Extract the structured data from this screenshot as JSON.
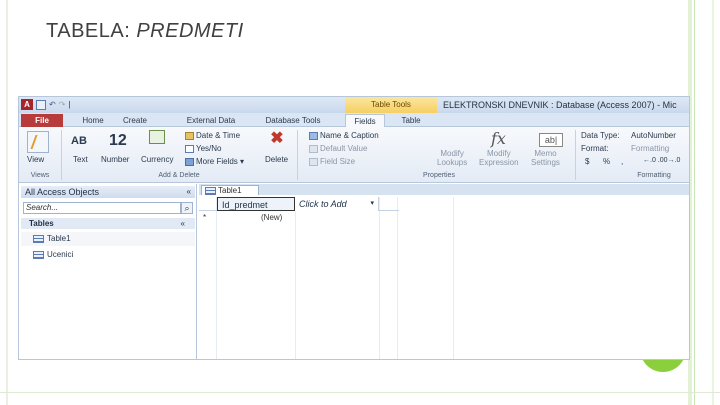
{
  "slide": {
    "title_plain": "Tabela: ",
    "title_italic": "Predmeti"
  },
  "window": {
    "title": "ELEKTRONSKI DNEVNIK : Database (Access 2007) - Mic",
    "contextual_tools": "Table Tools",
    "app_icon": "A",
    "qat_separator": "|"
  },
  "tabs": [
    "File",
    "Home",
    "Create",
    "External Data",
    "Database Tools",
    "Fields",
    "Table"
  ],
  "ribbon": {
    "view": "View",
    "views_label": "Views",
    "text_glyph": "AB",
    "text_label": "Text",
    "number_glyph": "12",
    "number_label": "Number",
    "currency_label": "Currency",
    "date_time": "Date & Time",
    "yes_no": "Yes/No",
    "more_fields": "More Fields",
    "more_fields_caret": "▾",
    "delete": "Delete",
    "add_delete_label": "Add & Delete",
    "name_caption": "Name & Caption",
    "default_value": "Default Value",
    "field_size": "Field Size",
    "modify_lookups": "Modify\nLookups",
    "modify_expression": "Modify\nExpression",
    "memo_settings": "Memo\nSettings",
    "abl_glyph": "ab|",
    "fx_glyph": "fx",
    "properties_label": "Properties",
    "data_type_label": "Data Type:",
    "data_type_value": "AutoNumber",
    "format_label": "Format:",
    "format_value": "Formatting",
    "currency_sym": "$",
    "percent_sym": "%",
    "comma_sym": ",",
    "decimals": "←.0 .00→.0",
    "formatting_label": "Formatting"
  },
  "nav": {
    "header": "All Access Objects",
    "header_chevron": "«",
    "search_placeholder": "Search...",
    "search_icon": "⌕",
    "section": "Tables",
    "section_chevron": "«",
    "items": [
      "Table1",
      "Ucenici"
    ]
  },
  "datasheet": {
    "tab": "Table1",
    "columns": [
      "Id_predmet",
      "Click to Add"
    ],
    "add_caret": "▾",
    "new_row_marker": "*",
    "new_row_value": "(New)"
  },
  "colors": {
    "file_tab": "#b83b3b",
    "contextual": "#f6cf63",
    "accent_green": "#8ccf3c"
  }
}
